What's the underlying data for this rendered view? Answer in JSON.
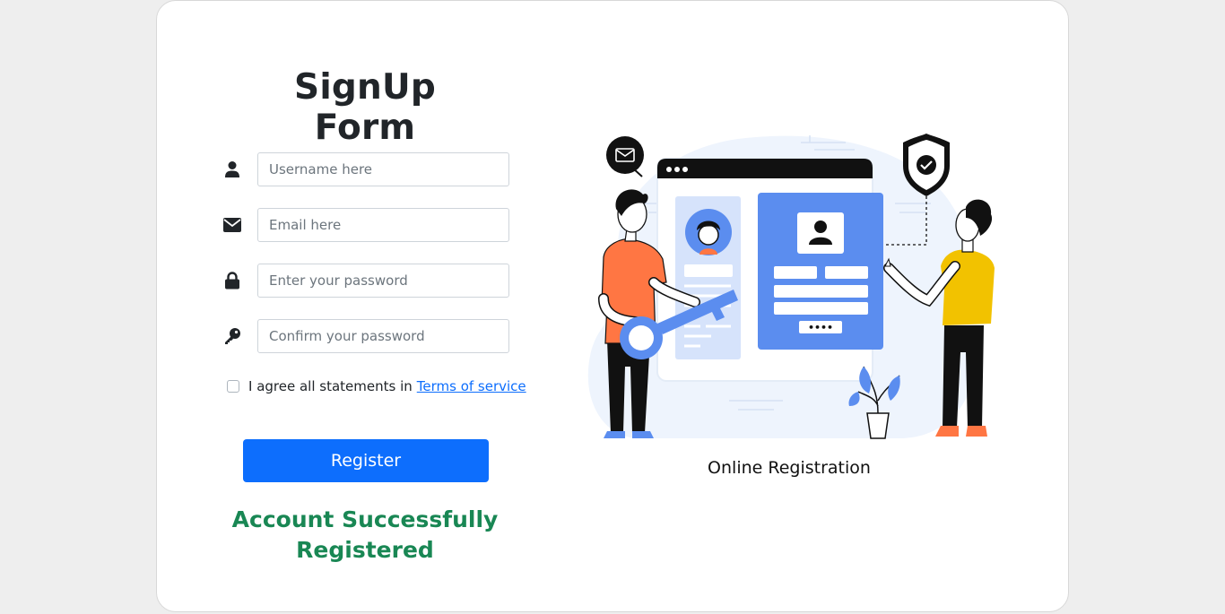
{
  "form": {
    "title": "SignUp Form",
    "fields": [
      {
        "name": "username",
        "icon": "user-icon",
        "placeholder": "Username here",
        "value": ""
      },
      {
        "name": "email",
        "icon": "envelope-icon",
        "placeholder": "Email here",
        "value": ""
      },
      {
        "name": "password",
        "icon": "lock-icon",
        "placeholder": "Enter your password",
        "value": ""
      },
      {
        "name": "confirm_password",
        "icon": "key-icon",
        "placeholder": "Confirm your password",
        "value": ""
      }
    ],
    "agree": {
      "checked": false,
      "text": "I agree all statements in",
      "link_text": "Terms of service"
    },
    "register_label": "Register",
    "success_message": "Account Successfully Registered"
  },
  "illustration": {
    "icon": "online-registration-illustration",
    "caption": "Online Registration",
    "password_dots": "••••"
  },
  "colors": {
    "primary": "#0d6efd",
    "success": "#198754",
    "illustration_blue": "#5b8def",
    "illustration_orange": "#ff7643",
    "illustration_yellow": "#f2c200"
  }
}
